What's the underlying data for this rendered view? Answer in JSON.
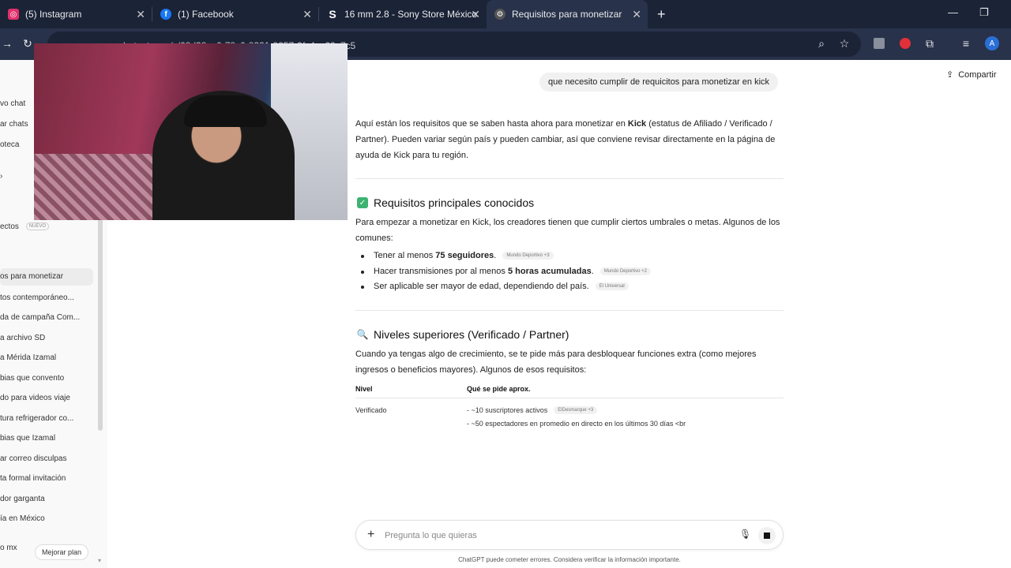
{
  "browser": {
    "tabs": [
      {
        "label": "(5) Instagram",
        "icon": "instagram-icon",
        "color": "#e1306c"
      },
      {
        "label": "(1) Facebook",
        "icon": "facebook-icon",
        "color": "#1877f2"
      },
      {
        "label": "16 mm 2.8 - Sony Store México",
        "icon": "sony-s-icon",
        "color": "#000000"
      },
      {
        "label": "Requisitos para monetizar",
        "icon": "chatgpt-icon",
        "color": "#555555",
        "active": true
      }
    ],
    "url": "chatgpt.com/c/68d38ac0-78c0-8331-9257-3fc4ac29c7c5"
  },
  "sidebar": {
    "items": [
      {
        "label": "vo chat"
      },
      {
        "label": "ar chats"
      },
      {
        "label": "oteca"
      },
      {
        "label": "ectos",
        "badge": "NUEVO"
      },
      {
        "label": "os para monetizar",
        "active": true
      },
      {
        "label": "tos contemporáneo..."
      },
      {
        "label": "da de campaña Com..."
      },
      {
        "label": "a archivo SD"
      },
      {
        "label": "a Mérida Izamal"
      },
      {
        "label": "bias que convento"
      },
      {
        "label": "do para videos viaje"
      },
      {
        "label": "tura refrigerador co..."
      },
      {
        "label": "bias que Izamal"
      },
      {
        "label": "ar correo disculpas"
      },
      {
        "label": "ta formal invitación"
      },
      {
        "label": "dor garganta"
      },
      {
        "label": "ía en México"
      }
    ],
    "account_label": "o mx",
    "upgrade_label": "Mejorar plan"
  },
  "header": {
    "share_label": "Compartir"
  },
  "chat": {
    "user_message": "que necesito cumplir de requicitos para monetizar en kick",
    "intro": {
      "before": "Aquí están los requisitos que se saben hasta ahora para monetizar en ",
      "bold": "Kick",
      "after": " (estatus de Afiliado / Verificado / Partner). Pueden variar según país y pueden cambiar, así que conviene revisar directamente en la página de ayuda de Kick para tu región."
    },
    "section1": {
      "title": "Requisitos principales conocidos",
      "text": "Para empezar a monetizar en Kick, los creadores tienen que cumplir ciertos umbrales o metas. Algunos de los comunes:",
      "bullets": [
        {
          "before": "Tener al menos ",
          "bold": "75 seguidores",
          "after": ".",
          "cite": "Mundo Deportivo +3"
        },
        {
          "before": "Hacer transmisiones por al menos ",
          "bold": "5 horas acumuladas",
          "after": ".",
          "cite": "Mundo Deportivo +2"
        },
        {
          "before": "Ser aplicable ser mayor de edad, dependiendo del país.",
          "bold": "",
          "after": "",
          "cite": "El Universal"
        }
      ]
    },
    "section2": {
      "title": "Niveles superiores (Verificado / Partner)",
      "text": "Cuando ya tengas algo de crecimiento, se te pide más para desbloquear funciones extra (como mejores ingresos o beneficios mayores). Algunos de esos requisitos:",
      "table": {
        "headers": [
          "Nivel",
          "Qué se pide aprox."
        ],
        "rows": [
          {
            "level": "Verificado",
            "line1": "- ~10 suscriptores activos",
            "cite": "ElDesmarque +3",
            "line2": "- ~50 espectadores en promedio en directo en los últimos 30 días <br"
          }
        ]
      }
    }
  },
  "composer": {
    "placeholder": "Pregunta lo que quieras",
    "disclaimer": "ChatGPT puede cometer errores. Considera verificar la información importante."
  }
}
